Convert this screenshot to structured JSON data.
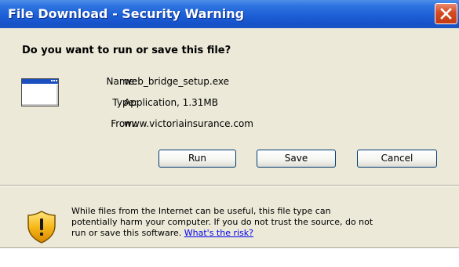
{
  "window": {
    "title": "File Download - Security Warning",
    "close_label": "✕"
  },
  "dialog": {
    "question": "Do you want to run or save this file?",
    "file_info": {
      "name_label": "Name:",
      "name_value": "web_bridge_setup.exe",
      "type_label": "Type:",
      "type_value": "Application, 1.31MB",
      "from_label": "From:",
      "from_value": "www.victoriainsurance.com"
    },
    "buttons": {
      "run": "Run",
      "save": "Save",
      "cancel": "Cancel"
    },
    "warning": {
      "line1": "While files from the Internet can be useful, this file type can",
      "line2": "potentially harm your computer. If you do not trust the source, do not",
      "line3_prefix": "run or save this software.",
      "link_text": "What's the risk?"
    },
    "icons": {
      "app": "application-window-icon",
      "warning": "security-shield-warning-icon",
      "close": "close-icon"
    }
  }
}
